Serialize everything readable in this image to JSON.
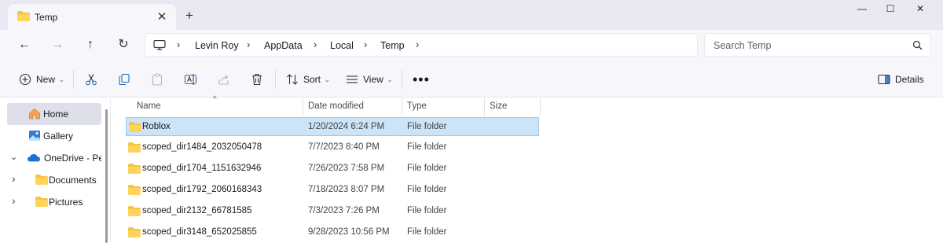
{
  "window": {
    "tab_title": "Temp",
    "tab_close": "✕",
    "new_tab": "+",
    "controls": {
      "minimize": "—",
      "maximize": "☐",
      "close": "✕"
    }
  },
  "nav": {
    "back": "←",
    "forward": "→",
    "up": "↑",
    "refresh": "↻",
    "breadcrumbs": [
      "Levin Roy",
      "AppData",
      "Local",
      "Temp"
    ],
    "separator": "›",
    "search_placeholder": "Search Temp"
  },
  "toolbar": {
    "new_label": "New",
    "sort_label": "Sort",
    "view_label": "View",
    "more_label": "•••",
    "details_label": "Details",
    "caret": "⌄"
  },
  "sidebar": {
    "items": [
      {
        "label": "Home",
        "icon": "home-icon",
        "active": true
      },
      {
        "label": "Gallery",
        "icon": "gallery-icon"
      },
      {
        "label": "OneDrive - Perso",
        "icon": "cloud-icon",
        "chevron": "⌄"
      },
      {
        "label": "Documents",
        "icon": "folder-icon",
        "chevron": "›"
      },
      {
        "label": "Pictures",
        "icon": "folder-icon",
        "chevron": "›"
      }
    ]
  },
  "files": {
    "sort_indicator": "^",
    "columns": [
      "Name",
      "Date modified",
      "Type",
      "Size"
    ],
    "rows": [
      {
        "name": "Roblox",
        "date": "1/20/2024 6:24 PM",
        "type": "File folder",
        "selected": true
      },
      {
        "name": "scoped_dir1484_2032050478",
        "date": "7/7/2023 8:40 PM",
        "type": "File folder"
      },
      {
        "name": "scoped_dir1704_1151632946",
        "date": "7/26/2023 7:58 PM",
        "type": "File folder"
      },
      {
        "name": "scoped_dir1792_2060168343",
        "date": "7/18/2023 8:07 PM",
        "type": "File folder"
      },
      {
        "name": "scoped_dir2132_66781585",
        "date": "7/3/2023 7:26 PM",
        "type": "File folder"
      },
      {
        "name": "scoped_dir3148_652025855",
        "date": "9/28/2023 10:56 PM",
        "type": "File folder"
      }
    ]
  },
  "colors": {
    "accent": "#0067c0",
    "folder": "#f4c542",
    "selection": "#cce4f7"
  }
}
